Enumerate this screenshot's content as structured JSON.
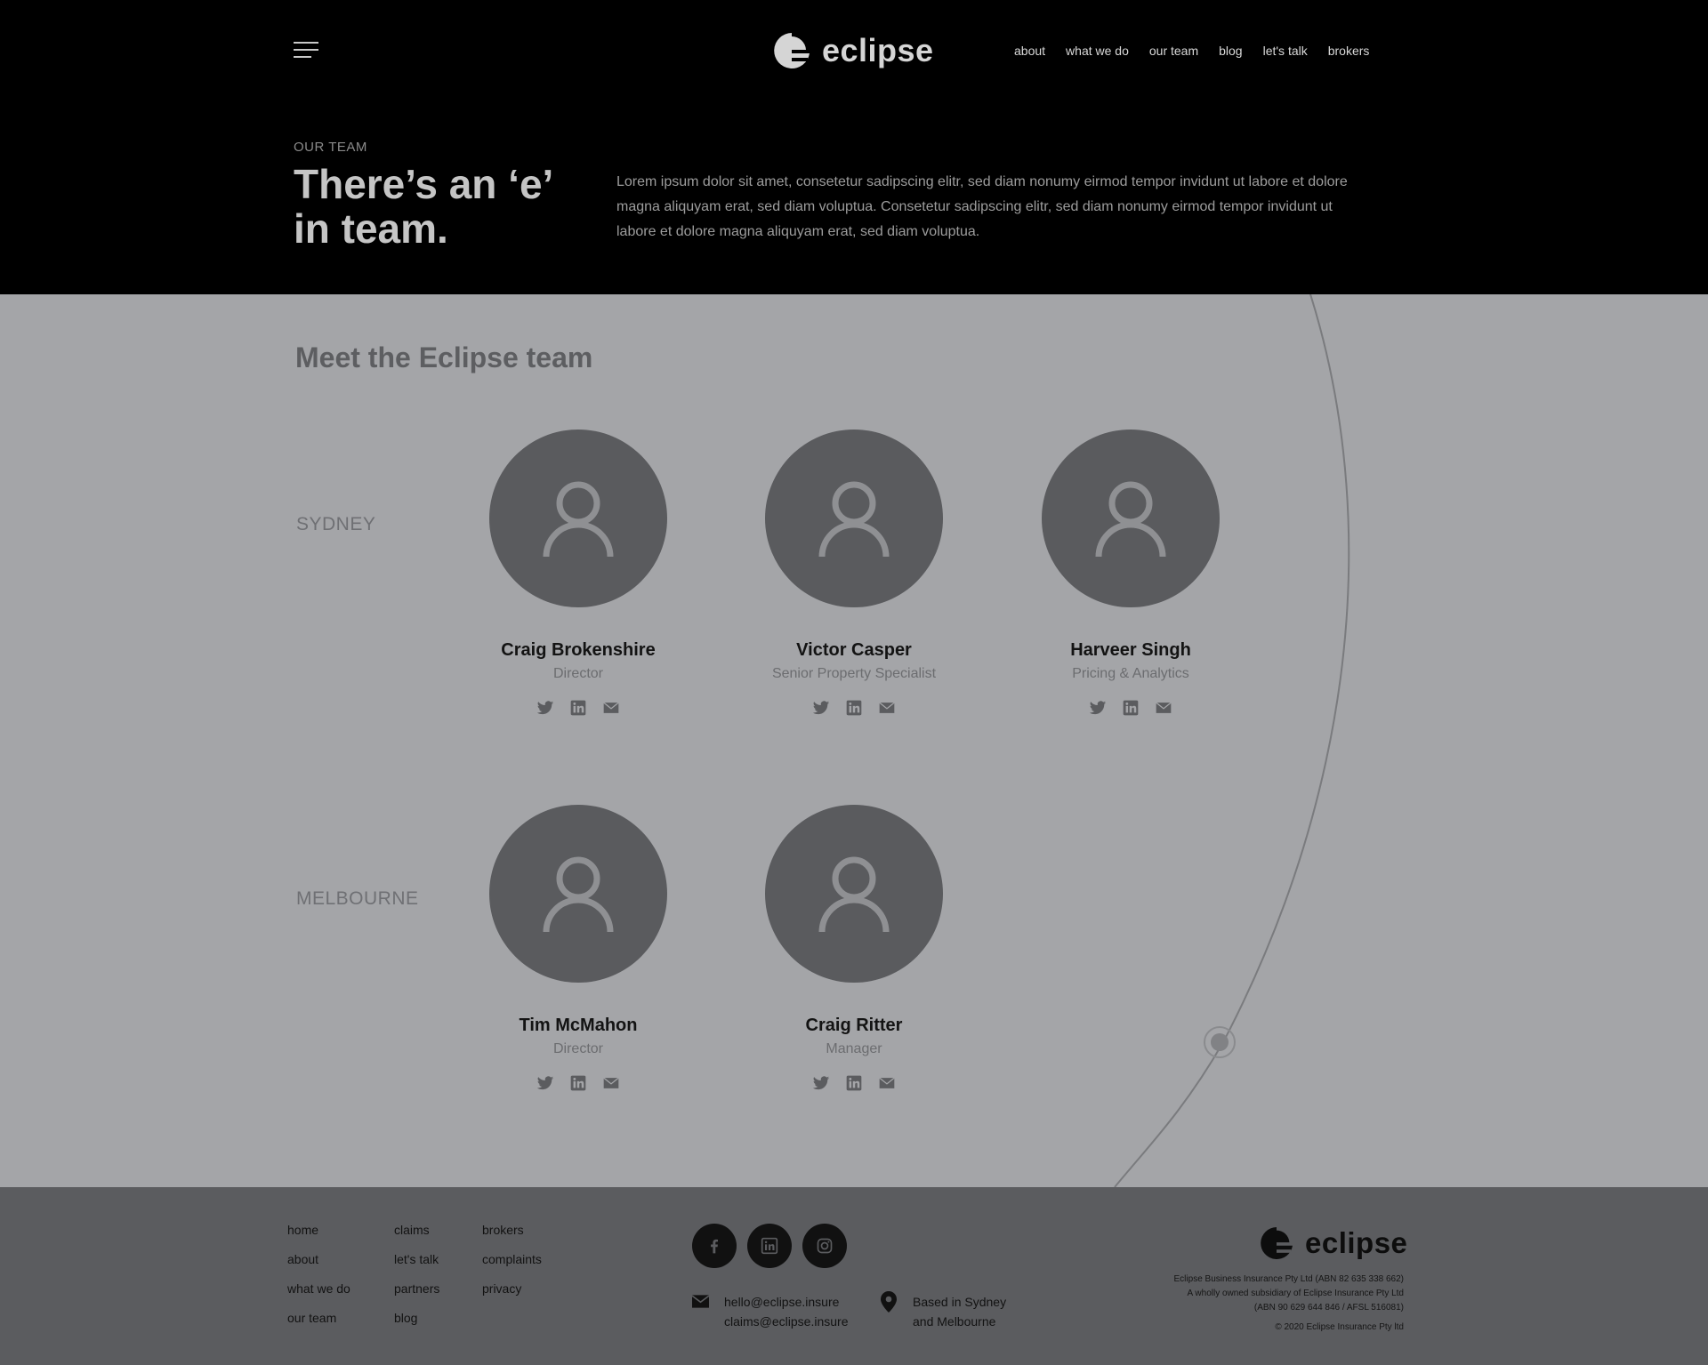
{
  "header": {
    "brand": "eclipse",
    "nav": [
      "about",
      "what we do",
      "our team",
      "blog",
      "let's talk",
      "brokers"
    ]
  },
  "hero": {
    "eyebrow": "OUR TEAM",
    "headline": "There’s an ‘e’ in team.",
    "intro": "Lorem ipsum dolor sit amet, consetetur sadipscing elitr, sed diam nonumy eirmod tempor invidunt ut labore et dolore magna aliquyam erat, sed diam voluptua. Consetetur sadipscing elitr, sed diam nonumy eirmod tempor invidunt ut labore et dolore magna aliquyam erat, sed diam voluptua."
  },
  "team": {
    "title": "Meet the Eclipse team",
    "cities": [
      "SYDNEY",
      "MELBOURNE"
    ],
    "members": [
      {
        "name": "Craig Brokenshire",
        "role": "Director"
      },
      {
        "name": "Victor Casper",
        "role": "Senior Property Specialist"
      },
      {
        "name": "Harveer Singh",
        "role": "Pricing & Analytics"
      },
      {
        "name": "Tim McMahon",
        "role": "Director"
      },
      {
        "name": "Craig Ritter",
        "role": "Manager"
      }
    ],
    "social_icons": [
      "twitter-icon",
      "linkedin-icon",
      "email-icon"
    ]
  },
  "footer": {
    "col1": [
      "home",
      "about",
      "what we do",
      "our team"
    ],
    "col2": [
      "claims",
      "let's talk",
      "partners",
      "blog"
    ],
    "col3": [
      "brokers",
      "complaints",
      "privacy"
    ],
    "social_icons": [
      "facebook-icon",
      "linkedin-icon",
      "instagram-icon"
    ],
    "emails": [
      "hello@eclipse.insure",
      "claims@eclipse.insure"
    ],
    "location": [
      "Based in Sydney",
      "and Melbourne"
    ],
    "brand": "eclipse",
    "legal": [
      "Eclipse Business Insurance Pty Ltd (ABN 82 635 338 662)",
      "A wholly owned subsidiary of Eclipse Insurance Pty Ltd",
      "(ABN 90 629 644 846 / AFSL 516081)"
    ],
    "copyright": "© 2020 Eclipse Insurance Pty ltd"
  },
  "colors": {
    "hero_bg": "#000000",
    "section_bg": "#a4a5a8",
    "footer_bg": "#5b5c5f",
    "avatar_bg": "#5a5b5e"
  }
}
